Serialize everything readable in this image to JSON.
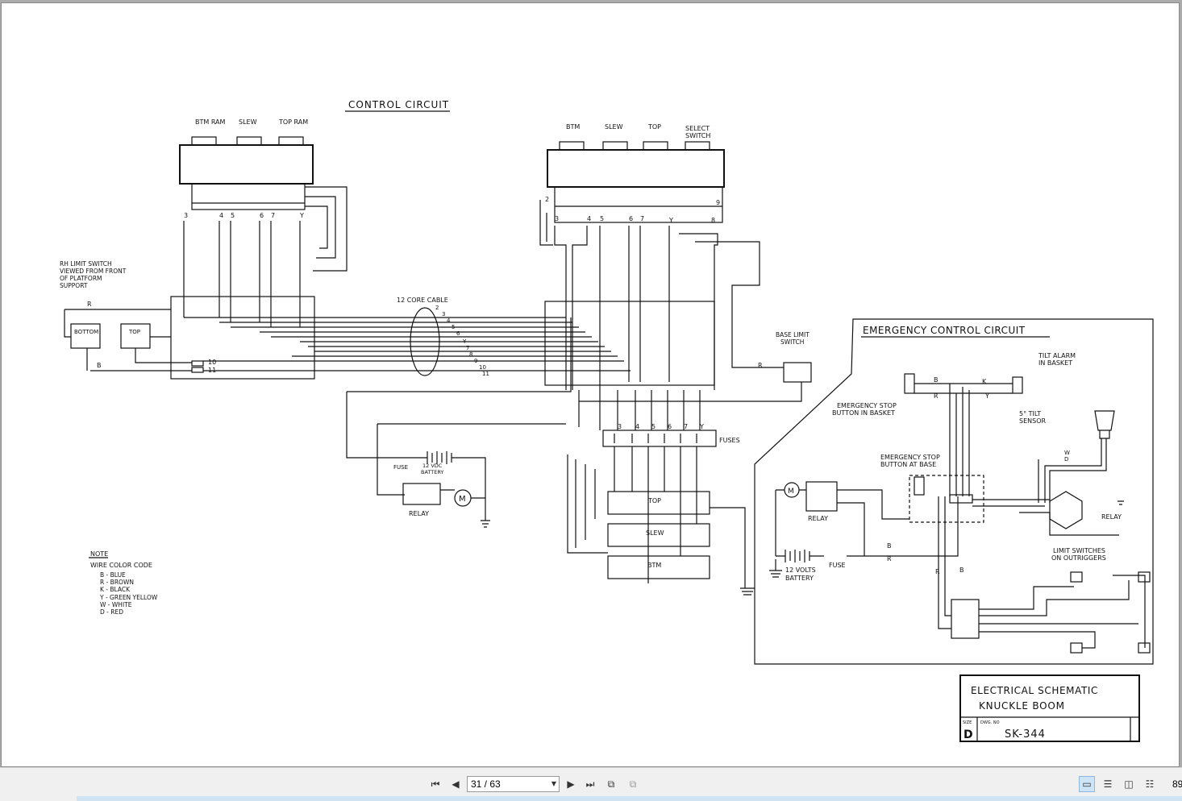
{
  "schematic": {
    "title_control": "CONTROL CIRCUIT",
    "left_valve_labels": [
      "BTM RAM",
      "SLEW",
      "TOP RAM"
    ],
    "right_valve_labels": [
      "BTM",
      "SLEW",
      "TOP",
      "SELECT SWITCH"
    ],
    "left_terminals": [
      "3",
      "4",
      "5",
      "6",
      "7",
      "Y"
    ],
    "right_terminals": [
      "2",
      "3",
      "4",
      "5",
      "6",
      "7",
      "Y",
      "9",
      "8"
    ],
    "rh_limit_note": "RH LIMIT SWITCH VIEWED FROM FRONT OF PLATFORM SUPPORT",
    "switch_bottom": "BOTTOM",
    "switch_top": "TOP",
    "cable_label": "12 CORE CABLE",
    "cable_wires": [
      "2",
      "3",
      "4",
      "5",
      "6",
      "Y",
      "7",
      "8",
      "9",
      "10",
      "11"
    ],
    "side_wires": [
      "10",
      "11"
    ],
    "wire_r": "R",
    "wire_b": "B",
    "base_limit_switch": "BASE LIMIT SWITCH",
    "fuse_label": "FUSE",
    "battery_label": "12 VDC BATTERY",
    "relay_label": "RELAY",
    "motor_label": "M",
    "fuses_label": "FUSES",
    "fuse_numbers": [
      "3",
      "4",
      "5",
      "6",
      "7",
      "Y"
    ],
    "solenoids": [
      "TOP",
      "SLEW",
      "BTM"
    ],
    "note_title": "NOTE",
    "note_heading": "WIRE COLOR CODE",
    "note_lines": [
      "B - BLUE",
      "R - BROWN",
      "K - BLACK",
      "Y - GREEN YELLOW",
      "W - WHITE",
      "D - RED"
    ],
    "emergency_title": "EMERGENCY CONTROL CIRCUIT",
    "tilt_alarm": "TILT ALARM IN BASKET",
    "estop_basket": "EMERGENCY STOP BUTTON IN BASKET",
    "tilt_sensor": "5° TILT SENSOR",
    "estop_base": "EMERGENCY STOP BUTTON AT BASE",
    "em_relay": "RELAY",
    "em_relay2": "RELAY",
    "em_battery": "12 VOLTS BATTERY",
    "em_fuse": "FUSE",
    "limit_switches": "LIMIT SWITCHES ON OUTRIGGERS",
    "wire_k": "K",
    "wire_y": "Y",
    "wire_w": "W",
    "wire_d": "D",
    "title_block_line1": "ELECTRICAL SCHEMATIC",
    "title_block_line2": "KNUCKLE BOOM",
    "size_label": "SIZE",
    "size_value": "D",
    "dwg_label": "DWG. NO",
    "dwg_number": "SK-344"
  },
  "toolbar": {
    "page_field": "31 / 63",
    "zoom": "89",
    "icons": [
      "first-page-icon",
      "previous-page-icon",
      "next-page-icon",
      "last-page-icon",
      "previous-view-icon",
      "next-view-icon",
      "single-page-icon",
      "continuous-icon",
      "facing-icon",
      "continuous-facing-icon"
    ]
  }
}
